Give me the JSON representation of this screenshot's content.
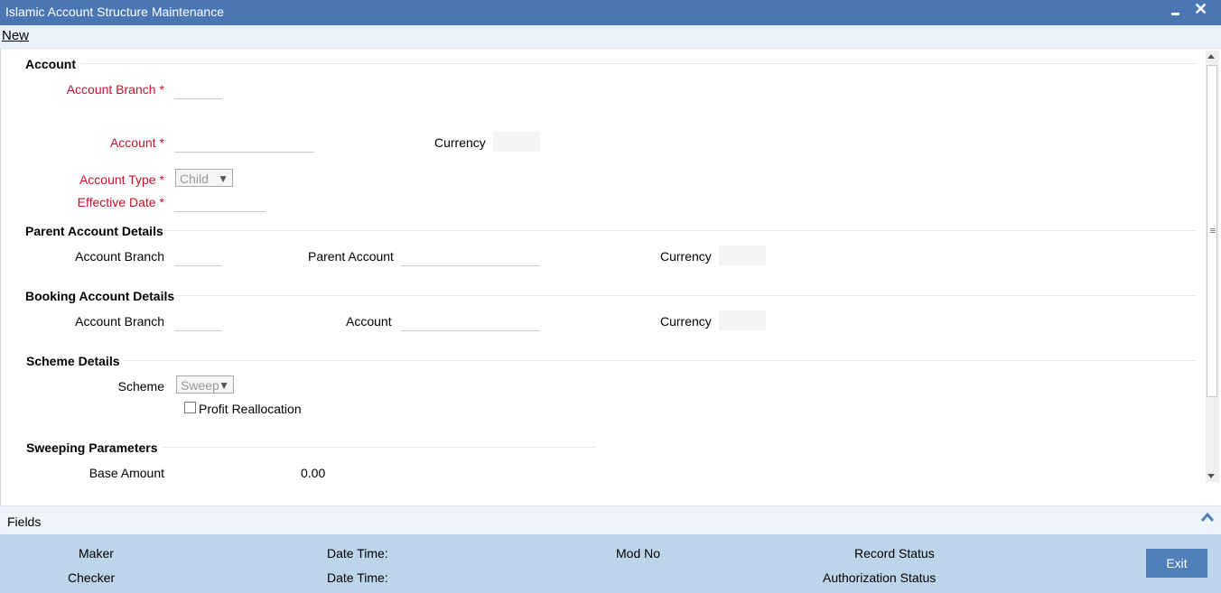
{
  "window": {
    "title": "Islamic Account Structure Maintenance"
  },
  "menu": {
    "new_label": "New"
  },
  "account": {
    "section_title": "Account",
    "branch_label": "Account Branch",
    "account_label": "Account",
    "currency_label": "Currency",
    "type_label": "Account Type",
    "type_value": "Child",
    "effective_date_label": "Effective Date",
    "required_mark": "*"
  },
  "parent": {
    "section_title": "Parent Account Details",
    "branch_label": "Account Branch",
    "account_label": "Parent Account",
    "currency_label": "Currency"
  },
  "booking": {
    "section_title": "Booking Account Details",
    "branch_label": "Account Branch",
    "account_label": "Account",
    "currency_label": "Currency"
  },
  "scheme": {
    "section_title": "Scheme Details",
    "scheme_label": "Scheme",
    "scheme_value": "Sweep",
    "profit_label": "Profit Reallocation"
  },
  "sweeping": {
    "section_title": "Sweeping Parameters",
    "base_amount_label": "Base Amount",
    "base_amount_value": "0.00"
  },
  "fields_bar": {
    "label": "Fields"
  },
  "footer": {
    "maker": "Maker",
    "checker": "Checker",
    "date_time_1": "Date Time:",
    "date_time_2": "Date Time:",
    "mod_no": "Mod No",
    "record_status": "Record Status",
    "authorization_status": "Authorization Status",
    "exit_label": "Exit"
  },
  "colors": {
    "title_bar": "#4a77b4",
    "required_label": "#c8102e",
    "footer_bg": "#bdd5ea",
    "exit_button": "#4f80ba"
  }
}
